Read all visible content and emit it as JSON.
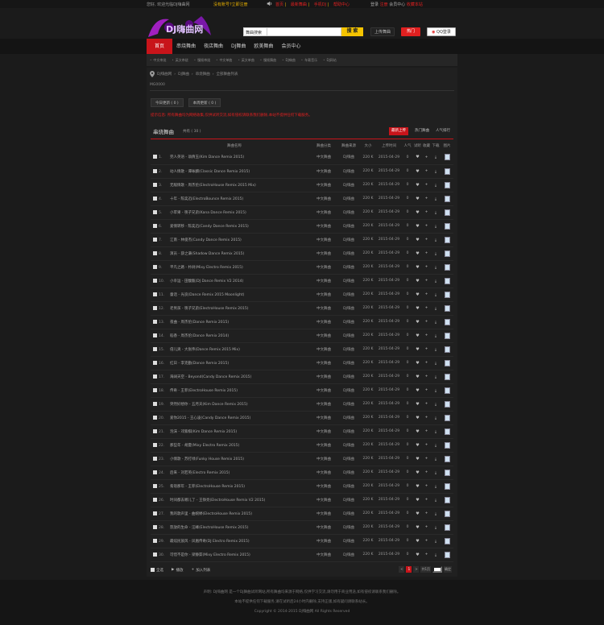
{
  "topbar": {
    "welcome": "您好, 欢迎光临DJ嗨曲网",
    "notice": "没有账号?立即注册",
    "links": [
      "首页",
      "最新舞曲",
      "手机DJ",
      "帮助中心"
    ],
    "right": [
      "登录",
      "注册",
      "会员中心",
      "收藏本站"
    ]
  },
  "header": {
    "logo_text": "DJ嗨曲网",
    "search_type": "舞曲搜索",
    "search_placeholder": "",
    "search_button": "搜 索",
    "upload_button": "上传舞曲",
    "hot_button": "热门",
    "qq_button": "QQ登录"
  },
  "nav": {
    "items": [
      "首页",
      "串烧舞曲",
      "夜店舞曲",
      "DJ舞曲",
      "欧美舞曲",
      "会员中心"
    ]
  },
  "subnav": {
    "items": [
      "中文串烧",
      "英文串烧",
      "慢摇串烧",
      "中文单曲",
      "英文单曲",
      "慢摇舞曲",
      "DJ嗨曲",
      "车载音乐",
      "DJ网站"
    ]
  },
  "breadcrumb": [
    "DJ嗨曲网",
    "DJ舞曲",
    "串烧舞曲",
    "全部舞曲列表"
  ],
  "page_id": "MG0000",
  "stat_tabs": [
    "今日更新 ( 0 )",
    "本周更新 ( 0 )"
  ],
  "warning": "提示信息: 所有舞曲均为网络收集,仅供试听交流,如有侵权请联系我们删除,本站不提供任何下载服务。",
  "list": {
    "title": "串烧舞曲",
    "count": "共有 ( 30 )",
    "sort_options": [
      "最新上传",
      "热门舞曲",
      "人气排行"
    ],
    "columns": [
      "",
      "舞曲名称",
      "舞曲分类",
      "舞曲来源",
      "大小",
      "上传时间",
      "人气",
      "试听",
      "收藏",
      "下载",
      "图片"
    ],
    "rows": [
      {
        "n": "1.",
        "name": "完人英语 - 翁倩玉(Kim Dance Remix 2015)",
        "cat": "中文舞曲",
        "src": "DJ嗨曲",
        "size": "220 K",
        "date": "2015-04-29",
        "hits": "0"
      },
      {
        "n": "2.",
        "name": "动人情歌 - 谭咏麟(Classic Dance Remix 2015)",
        "cat": "中文舞曲",
        "src": "DJ嗨曲",
        "size": "220 K",
        "date": "2015-04-29",
        "hits": "0"
      },
      {
        "n": "3.",
        "name": "无敌情歌 - 周杰伦(ElectroHouse Remix 2015 Mix)",
        "cat": "中文舞曲",
        "src": "DJ嗨曲",
        "size": "220 K",
        "date": "2015-04-29",
        "hits": "0"
      },
      {
        "n": "4.",
        "name": "十年 - 陈奕迅(ElectroBounce Remix 2015)",
        "cat": "中文舞曲",
        "src": "DJ嗨曲",
        "size": "220 K",
        "date": "2015-04-29",
        "hits": "0"
      },
      {
        "n": "5.",
        "name": "小苹果 - 筷子兄弟(Kana Dance Remix 2015)",
        "cat": "中文舞曲",
        "src": "DJ嗨曲",
        "size": "220 K",
        "date": "2015-04-29",
        "hits": "0"
      },
      {
        "n": "6.",
        "name": "爱情转移 - 陈奕迅(Candy Dance Remix 2015)",
        "cat": "中文舞曲",
        "src": "DJ嗨曲",
        "size": "220 K",
        "date": "2015-04-29",
        "hits": "0"
      },
      {
        "n": "7.",
        "name": "江南 - 林俊杰(Candy Dance Remix 2015)",
        "cat": "中文舞曲",
        "src": "DJ嗨曲",
        "size": "220 K",
        "date": "2015-04-29",
        "hits": "0"
      },
      {
        "n": "8.",
        "name": "演员 - 薛之谦(Shadow Dance Remix 2015)",
        "cat": "中文舞曲",
        "src": "DJ嗨曲",
        "size": "220 K",
        "date": "2015-04-29",
        "hits": "0"
      },
      {
        "n": "9.",
        "name": "平凡之路 - 朴树(Mixy Electro Remix 2015)",
        "cat": "中文舞曲",
        "src": "DJ嗨曲",
        "size": "220 K",
        "date": "2015-04-29",
        "hits": "0"
      },
      {
        "n": "10.",
        "name": "小幸运 - 田馥甄(DJ Dance Remix V2 2014)",
        "cat": "中文舞曲",
        "src": "DJ嗨曲",
        "size": "220 K",
        "date": "2015-04-29",
        "hits": "0"
      },
      {
        "n": "11.",
        "name": "童话 - 光良(Dance Remix 2015 Moonlight)",
        "cat": "中文舞曲",
        "src": "DJ嗨曲",
        "size": "220 K",
        "date": "2015-04-29",
        "hits": "0"
      },
      {
        "n": "12.",
        "name": "老男孩 - 筷子兄弟(ElectroHouse Remix 2015)",
        "cat": "中文舞曲",
        "src": "DJ嗨曲",
        "size": "220 K",
        "date": "2015-04-29",
        "hits": "0"
      },
      {
        "n": "13.",
        "name": "夜曲 - 周杰伦(Dance Remix 2015)",
        "cat": "中文舞曲",
        "src": "DJ嗨曲",
        "size": "220 K",
        "date": "2015-04-29",
        "hits": "0"
      },
      {
        "n": "14.",
        "name": "稻香 - 周杰伦(Dance Remix 2014)",
        "cat": "中文舞曲",
        "src": "DJ嗨曲",
        "size": "220 K",
        "date": "2015-04-29",
        "hits": "0"
      },
      {
        "n": "15.",
        "name": "倍儿爽 - 大张伟(Dance Remix 2015 Mix)",
        "cat": "中文舞曲",
        "src": "DJ嗨曲",
        "size": "220 K",
        "date": "2015-04-29",
        "hits": "0"
      },
      {
        "n": "16.",
        "name": "红日 - 李克勤(Dance Remix 2015)",
        "cat": "中文舞曲",
        "src": "DJ嗨曲",
        "size": "220 K",
        "date": "2015-04-29",
        "hits": "0"
      },
      {
        "n": "17.",
        "name": "海阔天空 - Beyond(Candy Dance Remix 2015)",
        "cat": "中文舞曲",
        "src": "DJ嗨曲",
        "size": "220 K",
        "date": "2015-04-29",
        "hits": "0"
      },
      {
        "n": "18.",
        "name": "传奇 - 王菲(ElectroHouse Remix 2015)",
        "cat": "中文舞曲",
        "src": "DJ嗨曲",
        "size": "220 K",
        "date": "2015-04-29",
        "hits": "0"
      },
      {
        "n": "19.",
        "name": "突然好想你 - 五月天(Kim Dance Remix 2015)",
        "cat": "中文舞曲",
        "src": "DJ嗨曲",
        "size": "220 K",
        "date": "2015-04-29",
        "hits": "0"
      },
      {
        "n": "20.",
        "name": "爱你2015 - 王心凌(Candy Dance Remix 2015)",
        "cat": "中文舞曲",
        "src": "DJ嗨曲",
        "size": "220 K",
        "date": "2015-04-29",
        "hits": "0"
      },
      {
        "n": "21.",
        "name": "泡沫 - 邓紫棋(Kim Dance Remix 2015)",
        "cat": "中文舞曲",
        "src": "DJ嗨曲",
        "size": "220 K",
        "date": "2015-04-29",
        "hits": "0"
      },
      {
        "n": "22.",
        "name": "那些年 - 胡夏(Mixy Electro Remix 2015)",
        "cat": "中文舞曲",
        "src": "DJ嗨曲",
        "size": "220 K",
        "date": "2015-04-29",
        "hits": "0"
      },
      {
        "n": "23.",
        "name": "小情歌 - 苏打绿(Funky House Remix 2015)",
        "cat": "中文舞曲",
        "src": "DJ嗨曲",
        "size": "220 K",
        "date": "2015-04-29",
        "hits": "0"
      },
      {
        "n": "24.",
        "name": "后来 - 刘若英(Electro Remix 2015)",
        "cat": "中文舞曲",
        "src": "DJ嗨曲",
        "size": "220 K",
        "date": "2015-04-29",
        "hits": "0"
      },
      {
        "n": "25.",
        "name": "匆匆那年 - 王菲(ElectroHouse Remix 2015)",
        "cat": "中文舞曲",
        "src": "DJ嗨曲",
        "size": "220 K",
        "date": "2015-04-29",
        "hits": "0"
      },
      {
        "n": "26.",
        "name": "时间都去哪儿了 - 王铮亮(ElectroHouse Remix V2 2015)",
        "cat": "中文舞曲",
        "src": "DJ嗨曲",
        "size": "220 K",
        "date": "2015-04-29",
        "hits": "0"
      },
      {
        "n": "27.",
        "name": "我的歌声里 - 曲婉婷(ElectroHouse Remix 2015)",
        "cat": "中文舞曲",
        "src": "DJ嗨曲",
        "size": "220 K",
        "date": "2015-04-29",
        "hits": "0"
      },
      {
        "n": "28.",
        "name": "怒放的生命 - 汪峰(ElectroHouse Remix 2015)",
        "cat": "中文舞曲",
        "src": "DJ嗨曲",
        "size": "220 K",
        "date": "2015-04-29",
        "hits": "0"
      },
      {
        "n": "29.",
        "name": "最炫民族风 - 凤凰传奇(DJ Electro Remix 2015)",
        "cat": "中文舞曲",
        "src": "DJ嗨曲",
        "size": "220 K",
        "date": "2015-04-29",
        "hits": "0"
      },
      {
        "n": "30.",
        "name": "可惜不是你 - 梁静茹(Mixy Electro Remix 2015)",
        "cat": "中文舞曲",
        "src": "DJ嗨曲",
        "size": "220 K",
        "date": "2015-04-29",
        "hits": "0"
      }
    ]
  },
  "bottom_bar": {
    "select_all": "全选",
    "play": "播放",
    "add_list": "加入列表",
    "pager": [
      "<",
      "1",
      ">",
      "共1页",
      "确定"
    ]
  },
  "footer": {
    "lines": [
      "声明: DJ嗨曲网 是一个DJ舞曲试听网站,所有舞曲均来源于网络,仅供学习交流,请勿用于商业用途,如有侵权请联系我们删除。",
      "本站不提供任何下载服务,请在试听后24小时内删除,支持正版,如有疑问请联系站长。",
      "Copyright © 2014-2015 DJ嗨曲网 All Rights Reserved"
    ]
  },
  "colors": {
    "accent": "#c8141a",
    "warning": "#e02020",
    "highlight": "#e8b000"
  }
}
